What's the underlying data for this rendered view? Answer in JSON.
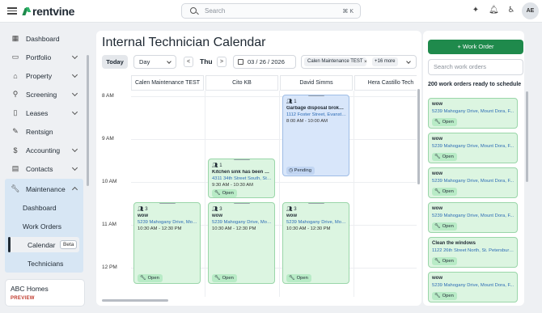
{
  "topbar": {
    "brand": "rentvine",
    "search_placeholder": "Search",
    "search_shortcut": "⌘ K",
    "avatar_initials": "AE"
  },
  "sidebar": {
    "items": [
      {
        "label": "Dashboard",
        "icon": "grid-icon"
      },
      {
        "label": "Portfolio",
        "icon": "briefcase-icon"
      },
      {
        "label": "Property",
        "icon": "home-icon"
      },
      {
        "label": "Screening",
        "icon": "user-search-icon"
      },
      {
        "label": "Leases",
        "icon": "file-icon"
      },
      {
        "label": "Rentsign",
        "icon": "signature-icon"
      },
      {
        "label": "Accounting",
        "icon": "dollar-icon"
      },
      {
        "label": "Contacts",
        "icon": "contacts-icon"
      },
      {
        "label": "Maintenance",
        "icon": "wrench-icon"
      }
    ],
    "maintenance_sub": [
      "Dashboard",
      "Work Orders",
      "Calendar",
      "Technicians"
    ],
    "beta_badge": "Beta",
    "company": {
      "name": "ABC Homes",
      "badge": "PREVIEW"
    }
  },
  "calendar": {
    "title": "Internal Technician Calendar",
    "today_label": "Today",
    "view_select": "Day",
    "prev_label": "<",
    "next_label": ">",
    "day_label": "Thu",
    "date_value": "03 / 26 / 2026",
    "filter_chip": "Calen Maintenance TEST",
    "filter_chip_remove": "×",
    "filter_more": "+16 more",
    "columns": [
      "Calen Maintenance TEST",
      "Cito KB",
      "David Simms",
      "Hera Castillo Tech"
    ],
    "times": [
      "8 AM",
      "9 AM",
      "10 AM",
      "11 AM",
      "12 PM"
    ],
    "events": [
      {
        "count": "1",
        "title": "Garbage disposal brokenwoe",
        "address": "1112 Foster Street, Evanston,...",
        "time": "8:00 AM - 10:00 AM",
        "status": "Pending"
      },
      {
        "count": "1",
        "title": "Kitchen sink has been drain...",
        "address": "4311 34th Street South, St. Pe...",
        "time": "9:30 AM - 10:30 AM",
        "status": "Open"
      },
      {
        "count": "3",
        "title": "wow",
        "address": "5239 Mahogany Drive, Mou...",
        "time": "10:30 AM - 12:30 PM",
        "status": "Open"
      },
      {
        "count": "3",
        "title": "wow",
        "address": "5239 Mahogany Drive, Mount...",
        "time": "10:30 AM - 12:30 PM",
        "status": "Open"
      },
      {
        "count": "3",
        "title": "wow",
        "address": "5239 Mahogany Drive, Mount...",
        "time": "10:30 AM - 12:30 PM",
        "status": "Open"
      }
    ]
  },
  "work_orders": {
    "add_button": "Work Order",
    "add_icon": "+",
    "search_placeholder": "Search work orders",
    "ready_text": "200 work orders ready to schedule",
    "cards": [
      {
        "title": "wow",
        "address": "5239 Mahogany Drive, Mount Dora, F...",
        "status": "Open"
      },
      {
        "title": "wow",
        "address": "5239 Mahogany Drive, Mount Dora, F...",
        "status": "Open"
      },
      {
        "title": "wow",
        "address": "5239 Mahogany Drive, Mount Dora, F...",
        "status": "Open"
      },
      {
        "title": "wow",
        "address": "5239 Mahogany Drive, Mount Dora, F...",
        "status": "Open"
      },
      {
        "title": "Clean the windows",
        "address": "1122 26th Street North, St. Petersburg...",
        "status": "Open"
      },
      {
        "title": "wow",
        "address": "5239 Mahogany Drive, Mount Dora, F...",
        "status": "Open"
      }
    ]
  },
  "colors": {
    "brand_green": "#1f8a4c",
    "event_green": "#dcf5e1",
    "event_blue": "#d8e6fa",
    "link_blue": "#2d6cb5"
  }
}
